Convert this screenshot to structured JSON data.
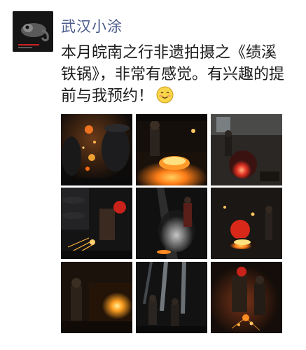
{
  "post": {
    "author": "武汉小涂",
    "text": "本月皖南之行非遗拍摄之《绩溪铁锅》，非常有感觉。有兴趣的提前与我预约！",
    "emoji": "smiling-face"
  },
  "avatar": {
    "description_icon": "chameleon-avatar-icon"
  },
  "photos": [
    {
      "name": "photo-sparks-by-drums"
    },
    {
      "name": "photo-worker-molten-iron"
    },
    {
      "name": "photo-red-hot-wok"
    },
    {
      "name": "photo-grinding-sparks"
    },
    {
      "name": "photo-steam-pouring"
    },
    {
      "name": "photo-glowing-molds"
    },
    {
      "name": "photo-casting-glow"
    },
    {
      "name": "photo-light-beams"
    },
    {
      "name": "photo-workers-sparks"
    }
  ],
  "colors": {
    "author": "#4a5b8c",
    "text": "#1b1b1b",
    "molten": "#ff8a1e",
    "hot_red": "#d8281a"
  }
}
